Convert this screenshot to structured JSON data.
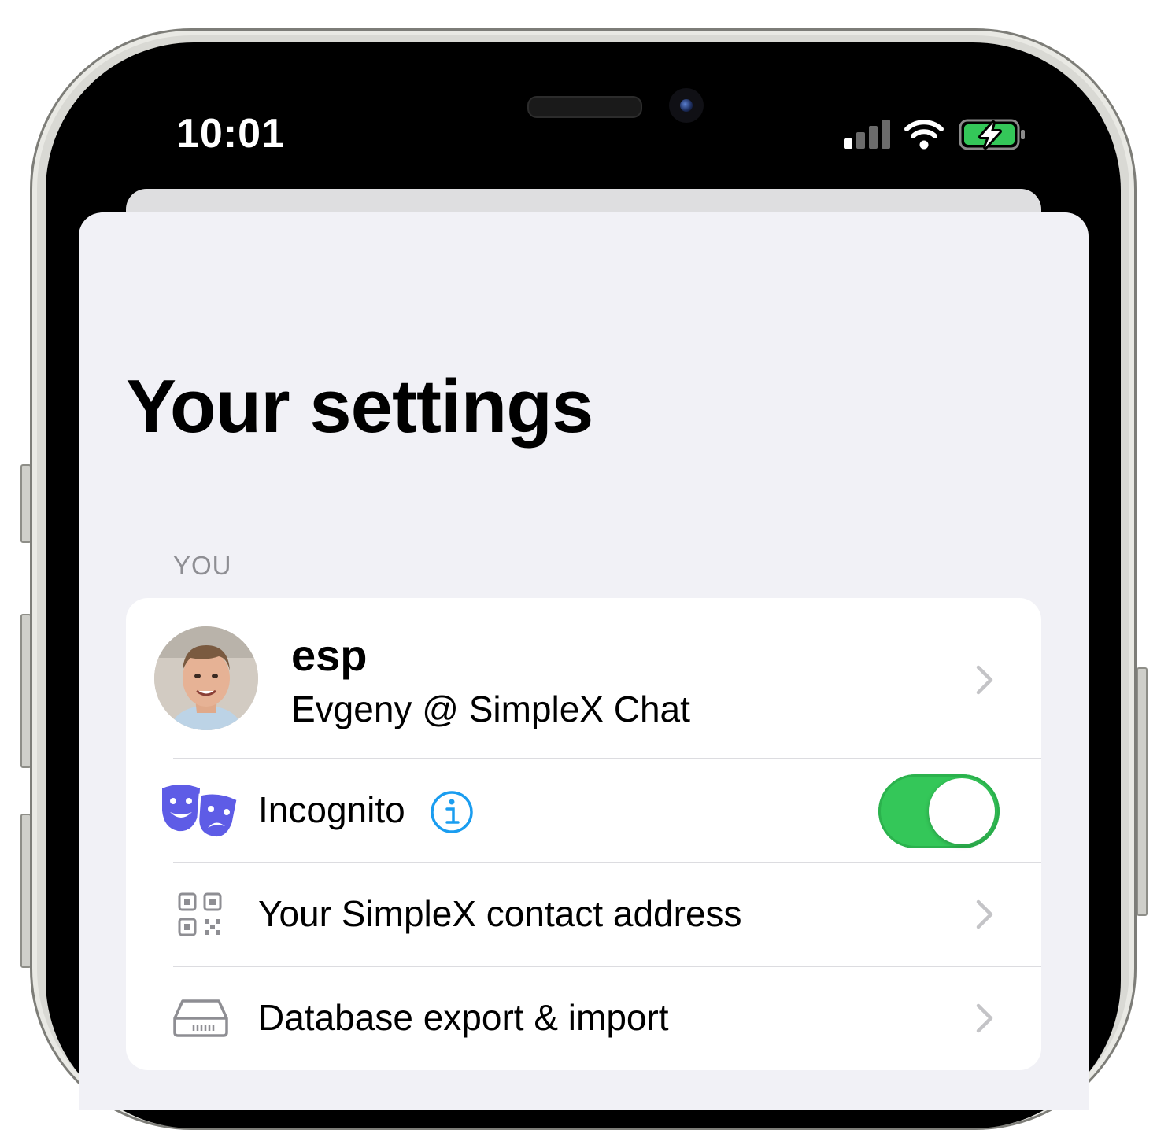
{
  "status_bar": {
    "time": "10:01",
    "signal_icon": "cellular-signal-icon",
    "wifi_icon": "wifi-icon",
    "battery_icon": "battery-charging-icon",
    "battery_color": "#34c759"
  },
  "page": {
    "title": "Your settings"
  },
  "section_you": {
    "header": "YOU",
    "profile": {
      "display_name": "esp",
      "full_name": "Evgeny @ SimpleX Chat",
      "avatar_icon": "profile-photo"
    },
    "items": [
      {
        "label": "Incognito",
        "icon": "theater-masks-icon",
        "info_icon": "info-icon",
        "toggle_on": true,
        "icon_color": "#5e5ce6",
        "info_color": "#1a9df0"
      },
      {
        "label": "Your SimpleX contact address",
        "icon": "qr-code-icon"
      },
      {
        "label": "Database export & import",
        "icon": "database-drive-icon"
      }
    ]
  },
  "colors": {
    "accent_green": "#34c759",
    "sheet_background": "#f1f1f6",
    "secondary_text": "#8e8e93"
  }
}
